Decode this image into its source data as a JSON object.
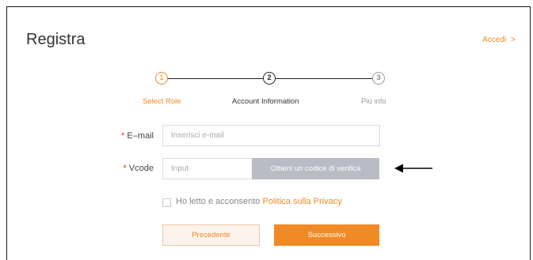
{
  "header": {
    "title": "Registra",
    "login_label": "Accedi",
    "login_chevron": ">"
  },
  "stepper": {
    "steps": [
      {
        "number": "1",
        "label": "Select Role",
        "state": "done"
      },
      {
        "number": "2",
        "label": "Account Information",
        "state": "current"
      },
      {
        "number": "3",
        "label": "Più info",
        "state": "future"
      }
    ]
  },
  "form": {
    "email": {
      "required_mark": "*",
      "label": "E–mail",
      "placeholder": "Inserisci e-mail"
    },
    "vcode": {
      "required_mark": "*",
      "label": "Vcode",
      "placeholder": "Input",
      "send_code_label": "Ottieni un codice di verifica"
    },
    "consent": {
      "text": "Ho letto e acconsento",
      "link": "Politica sulla Privacy",
      "checked": false
    }
  },
  "actions": {
    "prev_label": "Precedente",
    "next_label": "Successivo"
  },
  "annotation": {
    "icon": "arrow-left-icon"
  },
  "colors": {
    "accent": "#f08a24",
    "code_button": "#b9bcc4",
    "required": "#e33333"
  }
}
